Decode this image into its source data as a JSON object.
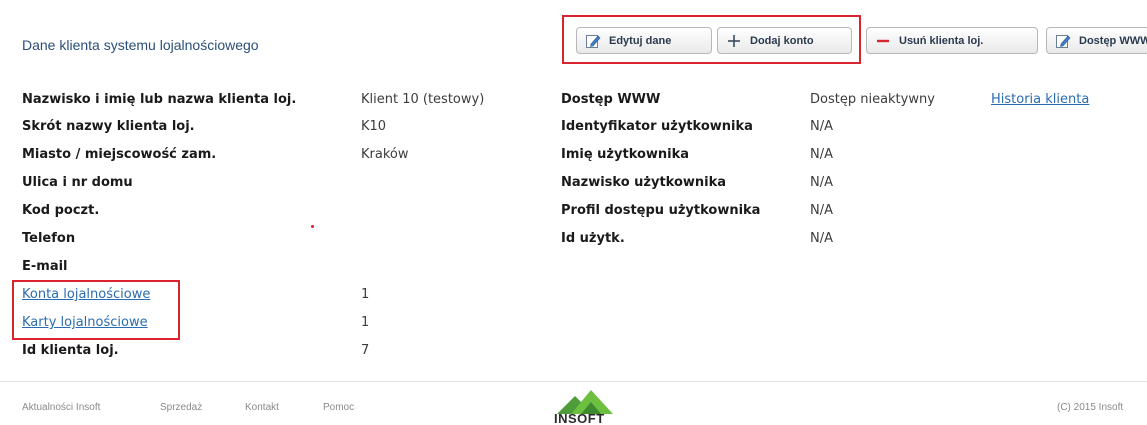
{
  "header": {
    "title": "Dane klienta systemu lojalnościowego"
  },
  "toolbar": {
    "edit_label": "Edytuj dane",
    "add_label": "Dodaj konto",
    "delete_label": "Usuń klienta loj.",
    "www_label": "Dostęp WWW",
    "accent_color": "#d9232e"
  },
  "client": {
    "name_label": "Nazwisko i imię lub nazwa klienta loj.",
    "name_value": "Klient 10 (testowy)",
    "short_label": "Skrót nazwy klienta loj.",
    "short_value": "K10",
    "city_label": "Miasto / miejscowość zam.",
    "city_value": "Kraków",
    "street_label": "Ulica i nr domu",
    "postal_label": "Kod poczt.",
    "phone_label": "Telefon",
    "email_label": "E-mail",
    "accounts_link": "Konta lojalnościowe",
    "accounts_value": "1",
    "cards_link": "Karty lojalnościowe",
    "cards_value": "1",
    "id_label": "Id klienta loj.",
    "id_value": "7"
  },
  "www": {
    "access_label": "Dostęp WWW",
    "access_value": "Dostęp nieaktywny",
    "history_link": "Historia klienta",
    "user_id_label": "Identyfikator użytkownika",
    "user_id_value": "N/A",
    "first_name_label": "Imię użytkownika",
    "first_name_value": "N/A",
    "last_name_label": "Nazwisko użytkownika",
    "last_name_value": "N/A",
    "profile_label": "Profil dostępu użytkownika",
    "profile_value": "N/A",
    "uid_label": "Id użytk.",
    "uid_value": "N/A"
  },
  "footer": {
    "news": "Aktualności Insoft",
    "sales": "Sprzedaż",
    "contact": "Kontakt",
    "help": "Pomoc",
    "logo_text": "INSOFT",
    "copyright": "(C) 2015 Insoft"
  }
}
